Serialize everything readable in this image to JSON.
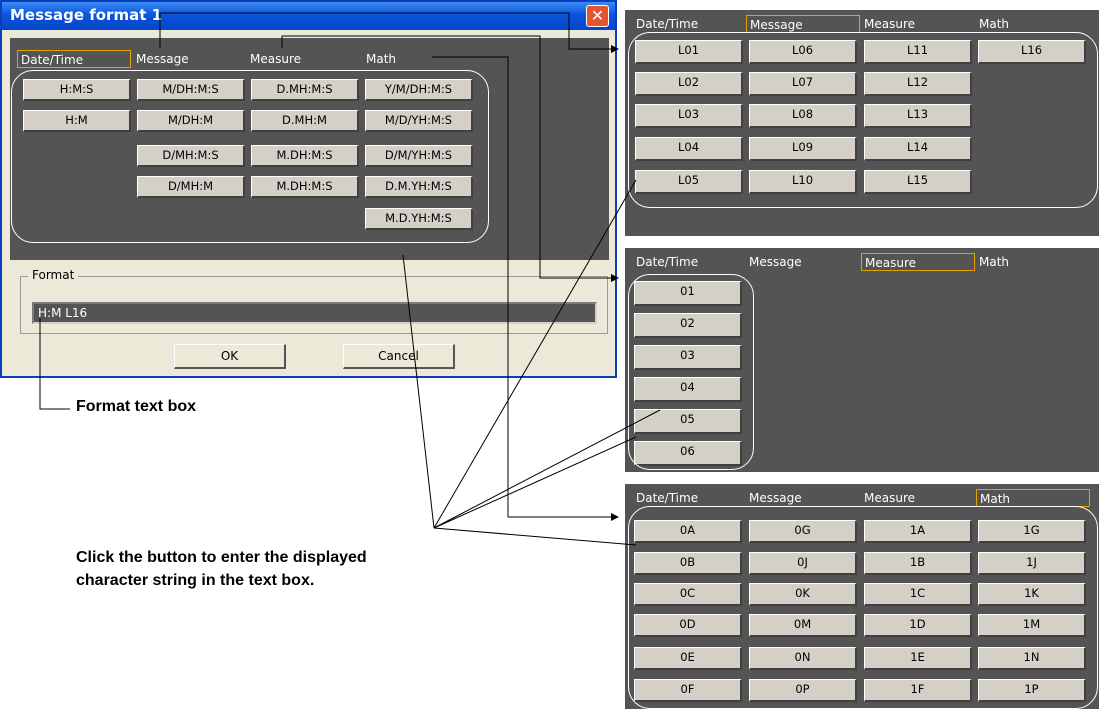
{
  "dialog": {
    "title": "Message format 1",
    "close_label": "✕",
    "tabs": [
      "Date/Time",
      "Message",
      "Measure",
      "Math"
    ],
    "selected_tab": "Date/Time",
    "buttons": [
      [
        "H:M:S",
        "M/DH:M:S",
        "D.MH:M:S",
        "Y/M/DH:M:S"
      ],
      [
        "H:M",
        "M/DH:M",
        "D.MH:M",
        "M/D/YH:M:S"
      ],
      [
        "",
        "D/MH:M:S",
        "M.DH:M:S",
        "D/M/YH:M:S"
      ],
      [
        "",
        "D/MH:M",
        "M.DH:M:S",
        "D.M.YH:M:S"
      ],
      [
        "",
        "",
        "",
        "M.D.YH:M:S"
      ]
    ],
    "format_label": "Format",
    "format_value": "H:M L16",
    "ok_label": "OK",
    "cancel_label": "Cancel"
  },
  "panels": {
    "message": {
      "tabs": [
        "Date/Time",
        "Message",
        "Measure",
        "Math"
      ],
      "selected_tab": "Message",
      "buttons": [
        [
          "L01",
          "L06",
          "L11",
          "L16"
        ],
        [
          "L02",
          "L07",
          "L12",
          ""
        ],
        [
          "L03",
          "L08",
          "L13",
          ""
        ],
        [
          "L04",
          "L09",
          "L14",
          ""
        ],
        [
          "L05",
          "L10",
          "L15",
          ""
        ]
      ]
    },
    "measure": {
      "tabs": [
        "Date/Time",
        "Message",
        "Measure",
        "Math"
      ],
      "selected_tab": "Measure",
      "buttons": [
        "01",
        "02",
        "03",
        "04",
        "05",
        "06"
      ]
    },
    "math": {
      "tabs": [
        "Date/Time",
        "Message",
        "Measure",
        "Math"
      ],
      "selected_tab": "Math",
      "buttons": [
        [
          "0A",
          "0G",
          "1A",
          "1G"
        ],
        [
          "0B",
          "0J",
          "1B",
          "1J"
        ],
        [
          "0C",
          "0K",
          "1C",
          "1K"
        ],
        [
          "0D",
          "0M",
          "1D",
          "1M"
        ],
        [
          "0E",
          "0N",
          "1E",
          "1N"
        ],
        [
          "0F",
          "0P",
          "1F",
          "1P"
        ]
      ]
    }
  },
  "annotations": {
    "format_text_box": "Format text box",
    "click_instruction_line1": "Click the button to enter the displayed",
    "click_instruction_line2": "character string in the text box."
  },
  "colors": {
    "panel_bg": "#545454",
    "selected_tab_border": "#e8a000",
    "titlebar": "#0a55de",
    "dialog_bg": "#ece9d8"
  }
}
